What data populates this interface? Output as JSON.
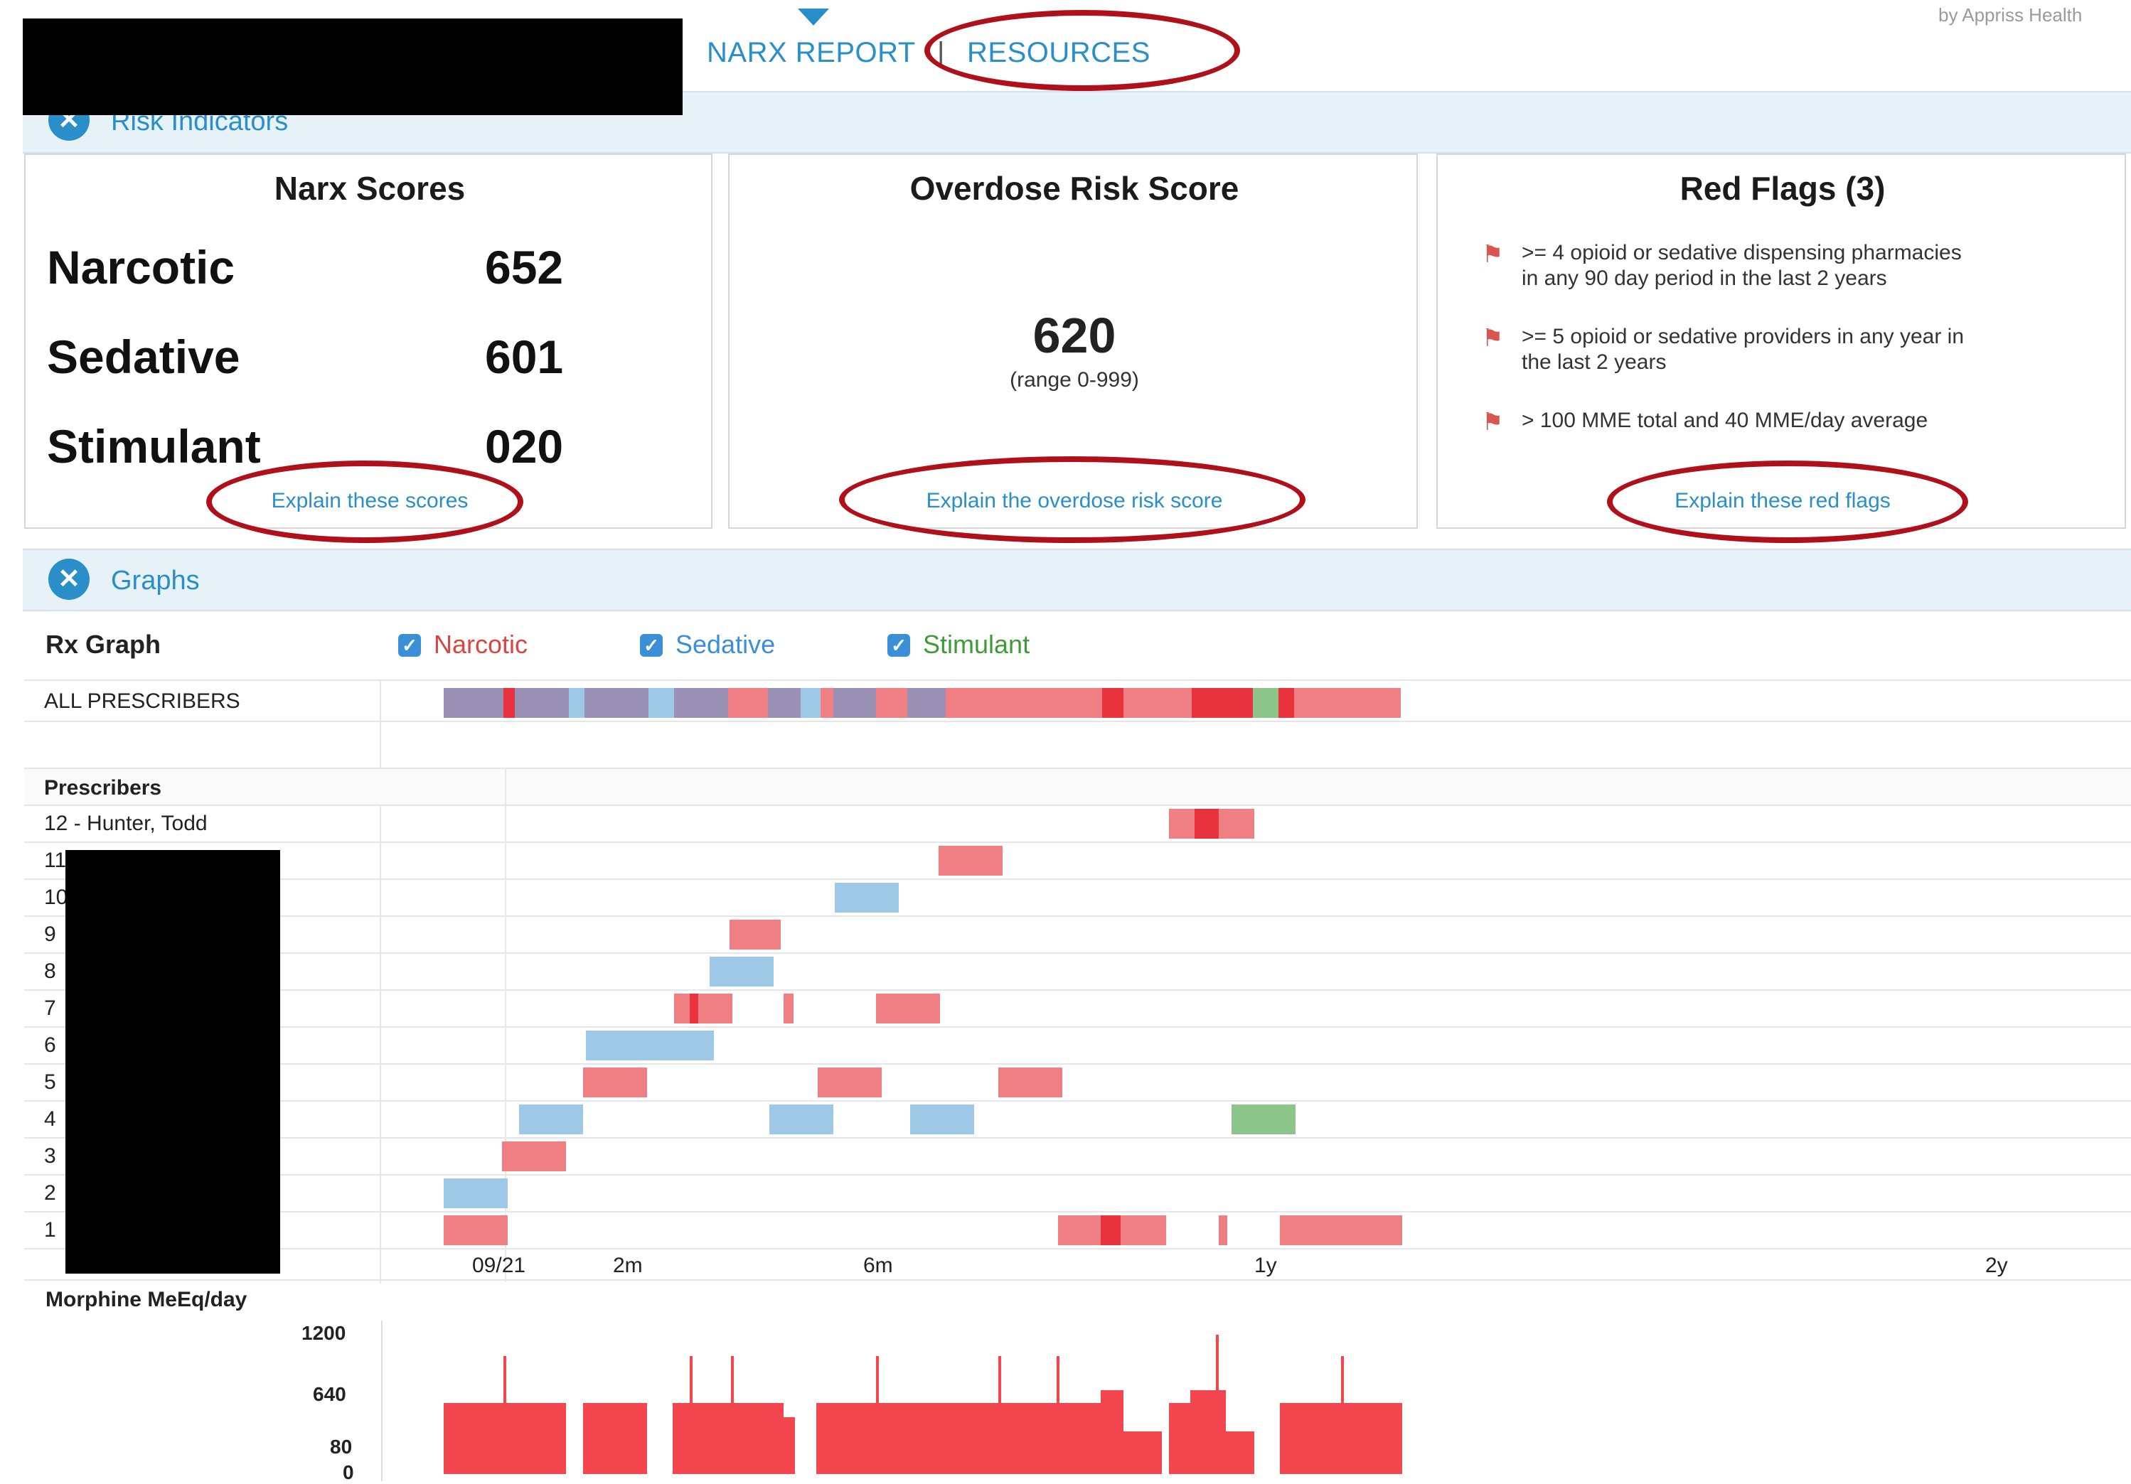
{
  "nav": {
    "narx_report": "NARX REPORT",
    "separator": "|",
    "resources": "RESOURCES",
    "brand": "by Appriss Health"
  },
  "risk_section": {
    "title": "Risk Indicators"
  },
  "narx_scores": {
    "title": "Narx Scores",
    "rows": [
      {
        "label": "Narcotic",
        "value": "652"
      },
      {
        "label": "Sedative",
        "value": "601"
      },
      {
        "label": "Stimulant",
        "value": "020"
      }
    ],
    "explain_link": "Explain these scores"
  },
  "overdose": {
    "title": "Overdose Risk Score",
    "value": "620",
    "range": "(range 0-999)",
    "explain_link": "Explain the overdose risk score"
  },
  "red_flags": {
    "title": "Red Flags (3)",
    "items": [
      {
        "line1": ">= 4 opioid or sedative dispensing pharmacies",
        "line2": "in any 90 day period in the last 2 years"
      },
      {
        "line1": ">= 5 opioid or sedative providers in any year in",
        "line2": "the last 2 years"
      },
      {
        "line1": "> 100 MME total and 40 MME/day average",
        "line2": ""
      }
    ],
    "explain_link": "Explain these red flags"
  },
  "graphs_section": {
    "title": "Graphs"
  },
  "rx_graph": {
    "title": "Rx Graph",
    "legend": [
      {
        "label": "Narcotic",
        "color": "#d9463f",
        "checked": true
      },
      {
        "label": "Sedative",
        "color": "#3a8fd6",
        "checked": true
      },
      {
        "label": "Stimulant",
        "color": "#3f9a3a",
        "checked": true
      }
    ],
    "all_prescribers_label": "ALL PRESCRIBERS",
    "prescribers_header": "Prescribers",
    "prescriber_rows": [
      "12 - Hunter, Todd",
      "11",
      "10",
      "9",
      "8",
      "7",
      "6",
      "5",
      "4",
      "3",
      "2",
      "1"
    ],
    "time_ticks": [
      "09/21",
      "2m",
      "6m",
      "1y",
      "2y"
    ],
    "colors": {
      "narcotic": "#f07f84",
      "narcotic_dark": "#e8323d",
      "sedative": "#9ec9e6",
      "stimulant": "#8cc48a",
      "mixed": "#9a8fb5"
    }
  },
  "mme": {
    "title": "Morphine MeEq/day",
    "ticks": [
      "1200",
      "640",
      "80",
      "0"
    ],
    "bar_color": "#f4464f"
  }
}
